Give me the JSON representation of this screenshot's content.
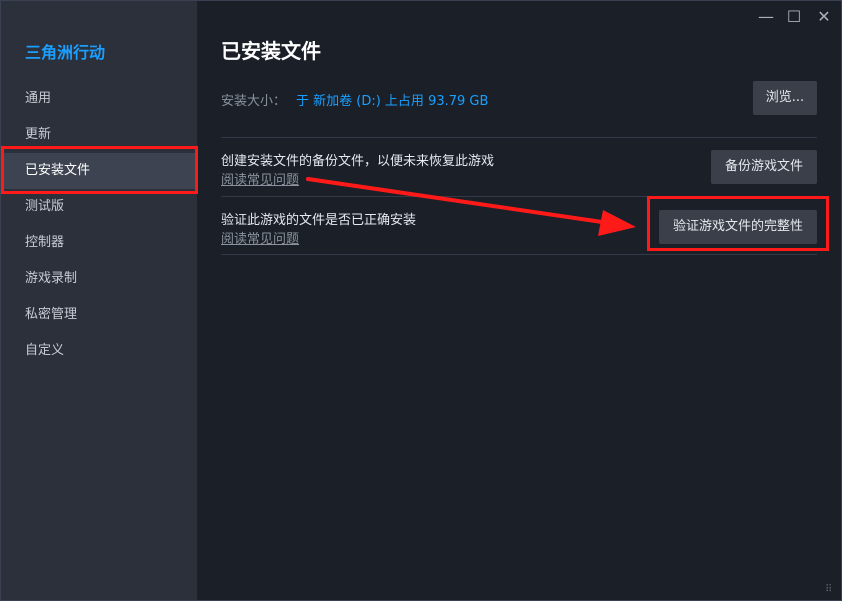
{
  "sidebar": {
    "title": "三角洲行动",
    "items": [
      {
        "label": "通用"
      },
      {
        "label": "更新"
      },
      {
        "label": "已安装文件"
      },
      {
        "label": "测试版"
      },
      {
        "label": "控制器"
      },
      {
        "label": "游戏录制"
      },
      {
        "label": "私密管理"
      },
      {
        "label": "自定义"
      }
    ],
    "active_index": 2
  },
  "main": {
    "title": "已安装文件",
    "install_size": {
      "label": "安装大小：",
      "value": "于 新加卷 (D:) 上占用 93.79 GB",
      "browse_label": "浏览..."
    },
    "backup": {
      "description": "创建安装文件的备份文件，以便未来恢复此游戏",
      "link": "阅读常见问题",
      "button_label": "备份游戏文件"
    },
    "verify": {
      "description": "验证此游戏的文件是否已正确安装",
      "link": "阅读常见问题",
      "button_label": "验证游戏文件的完整性"
    }
  },
  "window_controls": {
    "minimize": "—",
    "maximize": "☐",
    "close": "✕"
  },
  "colors": {
    "accent": "#1a9fff",
    "highlight": "#ff1a1a",
    "sidebar_bg": "#2b303b",
    "main_bg": "#1b2028"
  }
}
